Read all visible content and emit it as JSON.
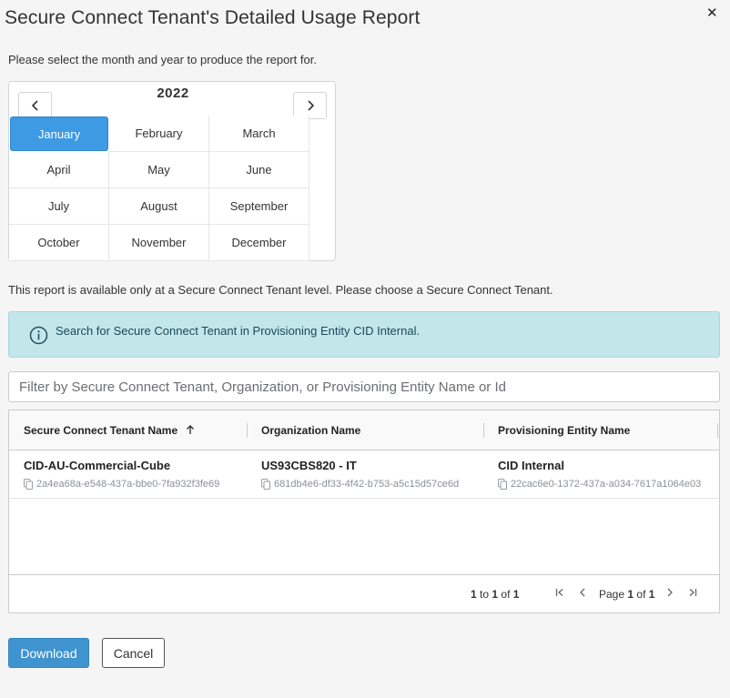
{
  "dialog": {
    "title": "Secure Connect Tenant's Detailed Usage Report",
    "prompt": "Please select the month and year to produce the report for.",
    "level_text": "This report is available only at a Secure Connect Tenant level. Please choose a Secure Connect Tenant."
  },
  "picker": {
    "year": "2022",
    "prev_icon": "chevron-left-icon",
    "next_icon": "chevron-right-icon",
    "selected": "January",
    "months": [
      "January",
      "February",
      "March",
      "April",
      "May",
      "June",
      "July",
      "August",
      "September",
      "October",
      "November",
      "December"
    ]
  },
  "info": {
    "text": "Search for Secure Connect Tenant in Provisioning Entity CID Internal.",
    "icon": "info-circle-icon"
  },
  "filter": {
    "placeholder": "Filter by Secure Connect Tenant, Organization, or Provisioning Entity Name or Id",
    "value": ""
  },
  "table": {
    "columns": [
      "Secure Connect Tenant Name",
      "Organization Name",
      "Provisioning Entity Name"
    ],
    "sort_icon": "arrow-up-icon",
    "rows": [
      {
        "tenant": "CID-AU-Commercial-Cube",
        "tenant_id": "2a4ea68a-e548-437a-bbe0-7fa932f3fe69",
        "org": "US93CBS820 - IT",
        "org_id": "681db4e6-df33-4f42-b753-a5c15d57ce6d",
        "entity": "CID Internal",
        "entity_id": "22cac6e0-1372-437a-a034-7617a1064e03"
      }
    ],
    "pager": {
      "range_from": "1",
      "range_to_word": "to",
      "range_to": "1",
      "range_of_word": "of",
      "range_total": "1",
      "page_word": "Page",
      "page": "1",
      "page_of_word": "of",
      "page_total": "1"
    }
  },
  "buttons": {
    "download": "Download",
    "cancel": "Cancel"
  },
  "colors": {
    "accent": "#3d9ae3",
    "primary_button": "#3f93cf",
    "info_bg": "#c3e6ea"
  }
}
